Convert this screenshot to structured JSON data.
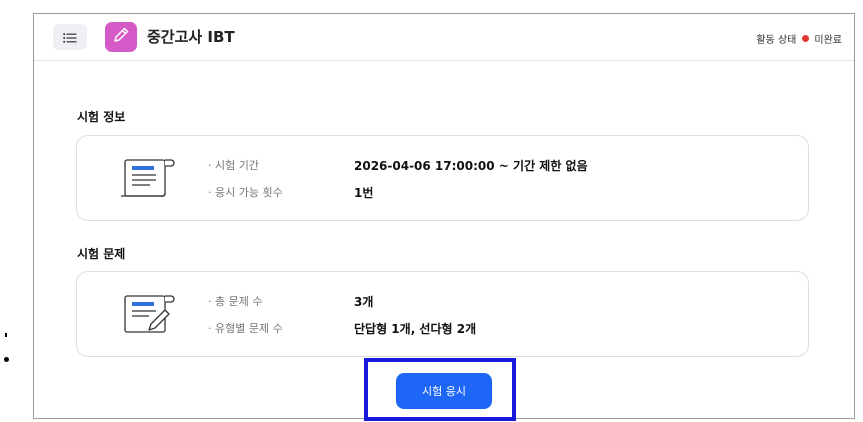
{
  "header": {
    "title": "중간고사 IBT",
    "status_label": "활동 상태",
    "status_value": "미완료",
    "status_color": "#e53935"
  },
  "exam_info": {
    "section_title": "시험 정보",
    "rows": [
      {
        "label": "· 시험 기간",
        "value": "2026-04-06 17:00:00 ~ 기간 제한 없음"
      },
      {
        "label": "· 응시 가능 횟수",
        "value": "1번"
      }
    ]
  },
  "exam_questions": {
    "section_title": "시험 문제",
    "rows": [
      {
        "label": "· 총 문제 수",
        "value": "3개"
      },
      {
        "label": "· 유형별 문제 수",
        "value": "단답형 1개, 선다형 2개"
      }
    ]
  },
  "actions": {
    "start_exam_label": "시험 응시"
  },
  "icons": {
    "menu": "list-menu-icon",
    "app": "pencil-icon",
    "info_card": "document-scroll-icon",
    "question_card": "document-pencil-icon"
  },
  "colors": {
    "accent": "#1e66f5",
    "app_icon_bg": "#d45ac8",
    "highlight_border": "#1a1adb"
  }
}
